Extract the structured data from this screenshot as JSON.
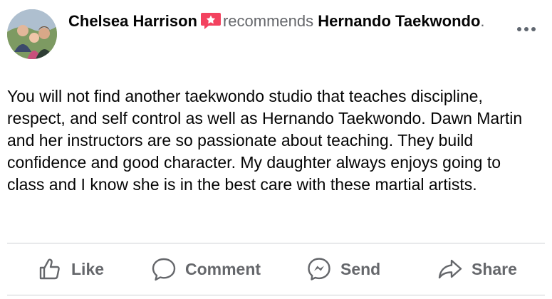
{
  "post": {
    "author": "Chelsea Harrison",
    "recommends_word": "recommends",
    "page_name": "Hernando Taekwondo",
    "trailing_dot": ".",
    "body": "You will not find another taekwondo studio that teaches discipline, respect, and self control as well as Hernando Taekwondo. Dawn Martin and her instructors are so passionate about teaching. They build confidence and good character. My daughter always enjoys going to class and I know she is in the best care with these martial artists."
  },
  "actions": {
    "like": "Like",
    "comment": "Comment",
    "send": "Send",
    "share": "Share"
  },
  "icons": {
    "recommend": "recommend-badge-icon",
    "more": "more-options-icon",
    "like": "thumbs-up-icon",
    "comment": "comment-bubble-icon",
    "send": "messenger-icon",
    "share": "share-arrow-icon"
  },
  "colors": {
    "recommend_badge": "#f3425f",
    "secondary_text": "#65676b",
    "divider": "#ced0d4"
  }
}
